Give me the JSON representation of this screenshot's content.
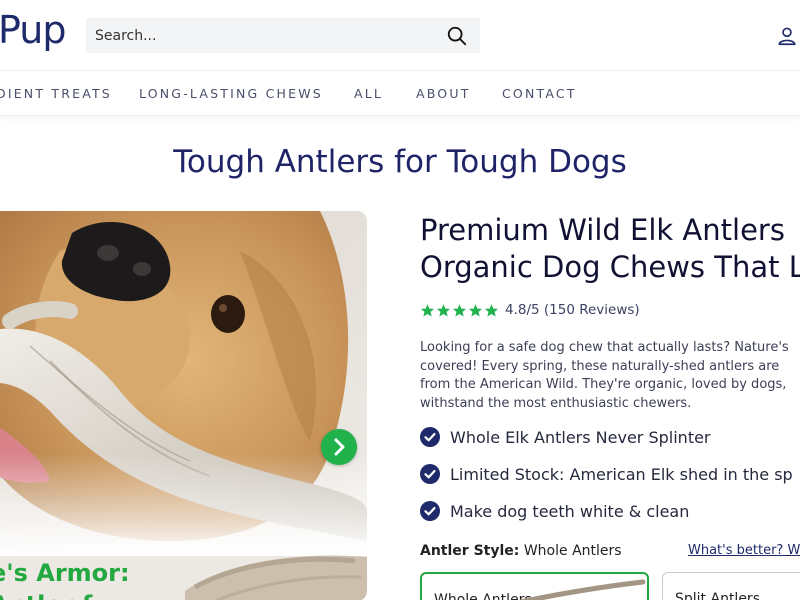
{
  "header": {
    "logo": "Pup",
    "search": {
      "placeholder": "Search..."
    }
  },
  "nav": {
    "items": [
      "DIENT TREATS",
      "LONG-LASTING CHEWS",
      "ALL",
      "ABOUT",
      "CONTACT"
    ]
  },
  "page": {
    "title": "Tough Antlers for Tough Dogs"
  },
  "gallery": {
    "caption_line1": "e's Armor:",
    "caption_line2": "Antler f"
  },
  "product": {
    "title_line1": "Premium Wild Elk Antlers",
    "title_line2": "Organic Dog Chews That L",
    "rating": {
      "stars": 5,
      "text": "4.8/5 (150 Reviews)"
    },
    "description": [
      "Looking for a safe dog chew that actually lasts? Nature's",
      "covered! Every spring, these naturally-shed antlers are",
      "from the American Wild. They're organic, loved by dogs,",
      "withstand the most enthusiastic chewers."
    ],
    "bullets": [
      "Whole Elk Antlers Never Splinter",
      "Limited Stock: American Elk shed in the sp",
      "Make dog teeth white & clean"
    ],
    "style": {
      "label": "Antler Style:",
      "value": "Whole Antlers",
      "help_link": "What's better? W",
      "options": [
        "Whole Antlers",
        "Split Antlers"
      ]
    }
  },
  "colors": {
    "brand_navy": "#1f2468",
    "accent_green": "#22a83f",
    "star_green": "#22b24c",
    "check_navy": "#1f2a6b"
  }
}
